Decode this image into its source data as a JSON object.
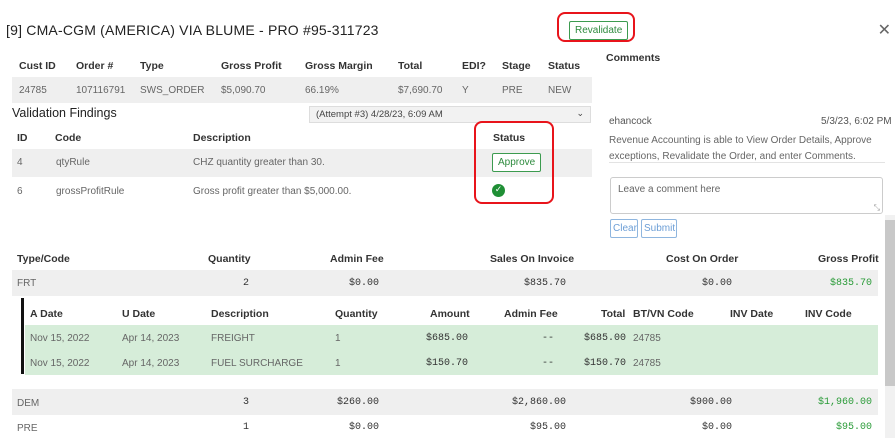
{
  "header": {
    "title": "[9] CMA-CGM (AMERICA) VIA BLUME - PRO #95-311723",
    "revalidate_label": "Revalidate",
    "close_glyph": "✕"
  },
  "order_table": {
    "columns": [
      "Cust ID",
      "Order #",
      "Type",
      "Gross Profit",
      "Gross Margin",
      "Total",
      "EDI?",
      "Stage",
      "Status"
    ],
    "row": [
      "24785",
      "107116791",
      "SWS_ORDER",
      "$5,090.70",
      "66.19%",
      "$7,690.70",
      "Y",
      "PRE",
      "NEW"
    ]
  },
  "validation": {
    "title": "Validation Findings",
    "attempt_select": "(Attempt #3) 4/28/23, 6:09 AM",
    "columns": [
      "ID",
      "Code",
      "Description",
      "Status"
    ],
    "rows": [
      {
        "id": "4",
        "code": "qtyRule",
        "description": "CHZ quantity greater than 30.",
        "status": "Approve"
      },
      {
        "id": "6",
        "code": "grossProfitRule",
        "description": "Gross profit greater than $5,000.00.",
        "status": "✓"
      }
    ]
  },
  "comments": {
    "title": "Comments",
    "author": "ehancock",
    "timestamp": "5/3/23, 6:02 PM",
    "body": "Revenue Accounting is able to View Order Details, Approve exceptions, Revalidate the Order, and enter Comments.",
    "placeholder": "Leave a comment here",
    "clear_label": "Clear",
    "submit_label": "Submit"
  },
  "charges": {
    "columns": [
      "Type/Code",
      "Quantity",
      "Admin Fee",
      "Sales On Invoice",
      "Cost On Order",
      "Gross Profit"
    ],
    "rows": [
      {
        "code": "FRT",
        "qty": "2",
        "admin": "$0.00",
        "sales": "$835.70",
        "cost": "$0.00",
        "gp": "$835.70"
      },
      {
        "code": "DEM",
        "qty": "3",
        "admin": "$260.00",
        "sales": "$2,860.00",
        "cost": "$900.00",
        "gp": "$1,960.00"
      },
      {
        "code": "PRE",
        "qty": "1",
        "admin": "$0.00",
        "sales": "$95.00",
        "cost": "$0.00",
        "gp": "$95.00"
      }
    ],
    "detail_columns": [
      "A Date",
      "U Date",
      "Description",
      "Quantity",
      "Amount",
      "Admin Fee",
      "Total",
      "BT/VN Code",
      "INV Date",
      "INV Code"
    ],
    "detail_rows": [
      {
        "a_date": "Nov 15, 2022",
        "u_date": "Apr 14, 2023",
        "desc": "FREIGHT",
        "qty": "1",
        "amount": "$685.00",
        "admin": "--",
        "total": "$685.00",
        "btvn": "24785"
      },
      {
        "a_date": "Nov 15, 2022",
        "u_date": "Apr 14, 2023",
        "desc": "FUEL SURCHARGE",
        "qty": "1",
        "amount": "$150.70",
        "admin": "--",
        "total": "$150.70",
        "btvn": "24785"
      }
    ]
  },
  "colors": {
    "accent_green": "#2a9b38",
    "highlight_red": "#e8141b",
    "link_blue": "#6c9ed6"
  }
}
